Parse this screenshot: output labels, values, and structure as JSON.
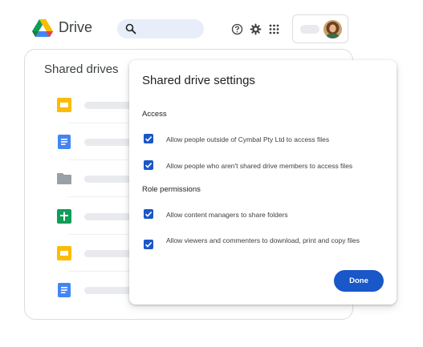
{
  "header": {
    "app_name": "Drive",
    "icons": [
      "google-drive-logo",
      "search-icon",
      "help-icon",
      "settings-icon",
      "apps-icon",
      "avatar"
    ]
  },
  "shared_drives": {
    "title": "Shared drives",
    "rows": [
      {
        "icon": "slides-icon",
        "color": "#fbbc04"
      },
      {
        "icon": "docs-icon",
        "color": "#4285f4"
      },
      {
        "icon": "folder-icon",
        "color": "#9aa0a6"
      },
      {
        "icon": "sheets-icon",
        "color": "#0f9d58"
      },
      {
        "icon": "slides-icon",
        "color": "#fbbc04"
      },
      {
        "icon": "docs-icon",
        "color": "#4285f4"
      }
    ]
  },
  "dialog": {
    "title": "Shared drive settings",
    "access_label": "Access",
    "access": [
      {
        "label": "Allow people outside of Cymbal Pty Ltd to access files",
        "checked": true
      },
      {
        "label": "Allow people who aren't shared drive members to access files",
        "checked": true
      }
    ],
    "role_label": "Role permissions",
    "roles": [
      {
        "label": "Allow content managers to share folders",
        "checked": true
      },
      {
        "label": "Allow viewers and commenters to download, print and copy files",
        "checked": true
      }
    ],
    "done_label": "Done"
  },
  "colors": {
    "accent": "#1a57c8",
    "search_bg": "#e8eef9"
  }
}
